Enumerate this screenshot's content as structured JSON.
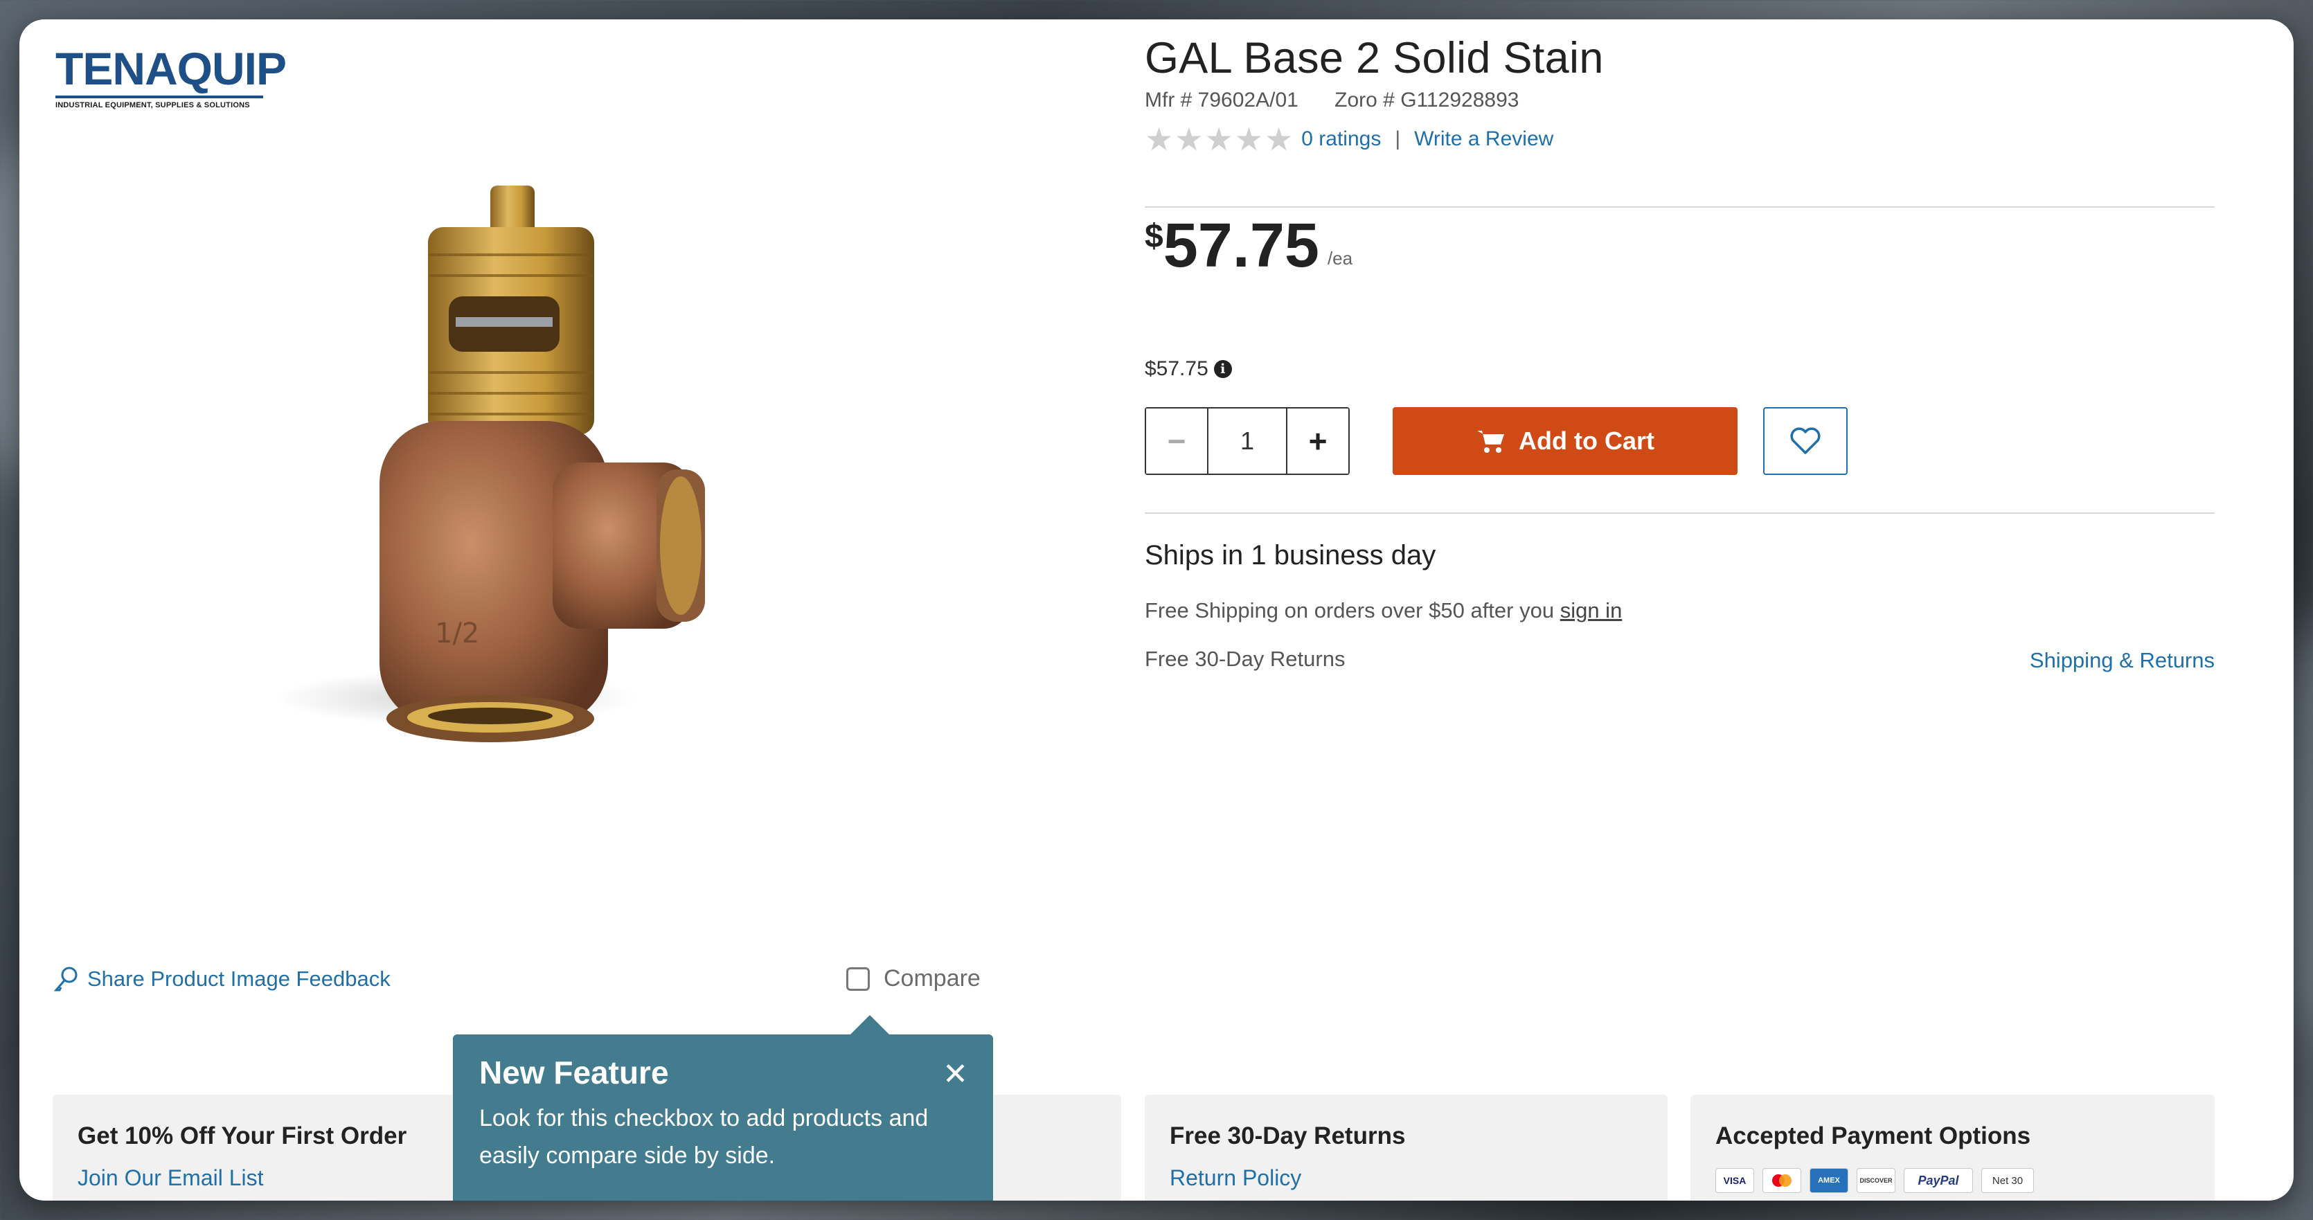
{
  "brand": {
    "name": "TENAQUIP",
    "tagline": "INDUSTRIAL EQUIPMENT, SUPPLIES & SOLUTIONS"
  },
  "product": {
    "title": "GAL Base 2 Solid Stain",
    "mfr": "Mfr # 79602A/01",
    "zoro": "Zoro # G112928893",
    "ratings_label": "0 ratings",
    "rating_value": 0,
    "rating_max": 5,
    "write_review": "Write a Review",
    "price_symbol": "$",
    "price_amount": "57.75",
    "price_unit": "/ea",
    "price_small": "$57.75",
    "quantity": "1",
    "add_to_cart": "Add to Cart"
  },
  "shipping": {
    "ships": "Ships in 1 business day",
    "free_ship_prefix": "Free Shipping on orders over $50 after you",
    "sign_in": "sign in",
    "returns": "Free 30-Day Returns",
    "shipping_returns_link": "Shipping & Returns"
  },
  "image_area": {
    "share_feedback": "Share Product Image Feedback",
    "compare": "Compare"
  },
  "tooltip": {
    "title": "New Feature",
    "body": "Look for this checkbox to add products and easily compare side by side."
  },
  "cards": {
    "email": {
      "title": "Get 10% Off Your First Order",
      "link": "Join Our Email List"
    },
    "returns": {
      "title": "Free 30-Day Returns",
      "link": "Return Policy"
    },
    "payment": {
      "title": "Accepted Payment Options",
      "methods": [
        "VISA",
        "Mastercard",
        "AMEX",
        "DISCOVER",
        "PayPal",
        "Net 30"
      ]
    }
  },
  "colors": {
    "brand_blue": "#1e4f86",
    "link_blue": "#1f6fa8",
    "cart_orange": "#d04a15",
    "tooltip_teal": "#437c8e"
  }
}
